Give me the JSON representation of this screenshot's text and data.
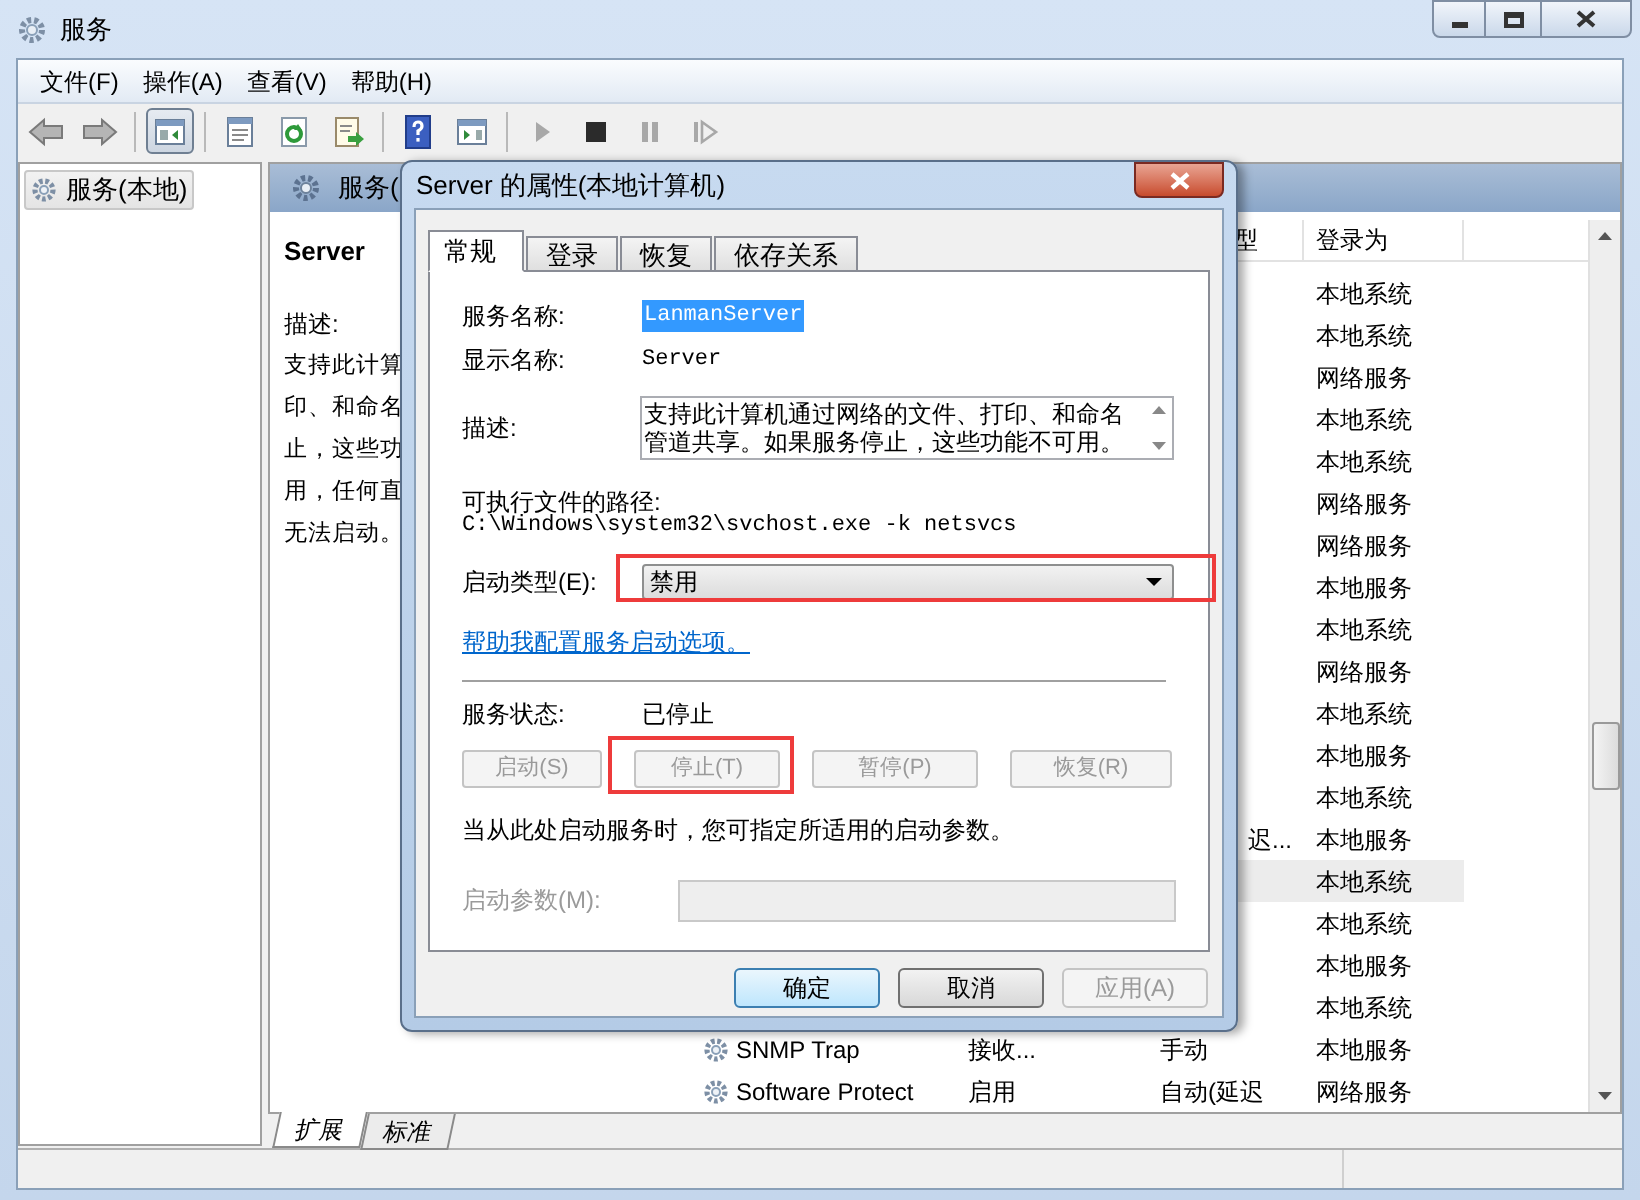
{
  "window": {
    "title": "服务"
  },
  "menu": [
    "文件(F)",
    "操作(A)",
    "查看(V)",
    "帮助(H)"
  ],
  "toolbar": [
    {
      "kind": "back"
    },
    {
      "kind": "forward"
    },
    {
      "kind": "separator"
    },
    {
      "kind": "console_tree",
      "pressed": true
    },
    {
      "kind": "separator"
    },
    {
      "kind": "properties"
    },
    {
      "kind": "refresh"
    },
    {
      "kind": "export"
    },
    {
      "kind": "separator"
    },
    {
      "kind": "help"
    },
    {
      "kind": "action_pane"
    },
    {
      "kind": "separator"
    },
    {
      "kind": "start",
      "disabled": true
    },
    {
      "kind": "stop",
      "disabled": false
    },
    {
      "kind": "pause",
      "disabled": true
    },
    {
      "kind": "restart",
      "disabled": true
    }
  ],
  "tree": [
    {
      "label": "服务(本地)",
      "selected": true
    }
  ],
  "services_panel": {
    "header": "服务(",
    "detail": {
      "title": "Server",
      "description_label": "描述:",
      "description_lines": [
        "支持此计算",
        "印、和命名",
        "止，这些功",
        "用，任何直",
        "无法启动。"
      ]
    },
    "columns": [
      "型",
      "登录为"
    ],
    "rows": [
      {
        "login_as": "本地系统",
        "selected": false
      },
      {
        "login_as": "本地系统",
        "selected": false
      },
      {
        "login_as": "网络服务",
        "selected": false
      },
      {
        "login_as": "本地系统",
        "selected": false
      },
      {
        "login_as": "本地系统",
        "selected": false
      },
      {
        "login_as": "网络服务",
        "selected": false
      },
      {
        "login_as": "网络服务",
        "selected": false
      },
      {
        "login_as": "本地服务",
        "selected": false
      },
      {
        "login_as": "本地系统",
        "selected": false
      },
      {
        "login_as": "网络服务",
        "selected": false
      },
      {
        "login_as": "本地系统",
        "selected": false
      },
      {
        "login_as": "本地服务",
        "selected": false
      },
      {
        "login_as": "本地系统",
        "selected": false
      },
      {
        "startup": "迟...",
        "login_as": "本地服务",
        "selected": false
      },
      {
        "login_as": "本地系统",
        "selected": true
      },
      {
        "login_as": "本地系统",
        "selected": false
      },
      {
        "login_as": "本地服务",
        "selected": false
      },
      {
        "login_as": "本地系统",
        "selected": false
      },
      {
        "name": "SNMP Trap",
        "description": "接收...",
        "startup": "手动",
        "login_as": "本地服务",
        "selected": false
      },
      {
        "name": "Software Protect",
        "description": "启用",
        "startup": "自动(延迟",
        "login_as": "网络服务",
        "selected": false
      }
    ]
  },
  "bottom_tabs": [
    {
      "label": "扩展",
      "selected": true
    },
    {
      "label": "标准",
      "selected": false
    }
  ],
  "dialog": {
    "title": "Server 的属性(本地计算机)",
    "tabs": [
      {
        "label": "常规",
        "selected": true
      },
      {
        "label": "登录",
        "selected": false
      },
      {
        "label": "恢复",
        "selected": false
      },
      {
        "label": "依存关系",
        "selected": false
      }
    ],
    "service_name": {
      "label": "服务名称:",
      "value": "LanmanServer",
      "selected": true
    },
    "display_name": {
      "label": "显示名称:",
      "value": "Server"
    },
    "description": {
      "label": "描述:",
      "value": "支持此计算机通过网络的文件、打印、和命名管道共享。如果服务停止，这些功能不可用。"
    },
    "path": {
      "label": "可执行文件的路径:",
      "value": "C:\\Windows\\system32\\svchost.exe -k netsvcs"
    },
    "startup_type": {
      "label": "启动类型(E):",
      "value": "禁用",
      "highlighted": true
    },
    "help_link": "帮助我配置服务启动选项。",
    "status": {
      "label": "服务状态:",
      "value": "已停止"
    },
    "service_buttons": [
      {
        "label": "启动(S)",
        "disabled": true,
        "highlighted": false
      },
      {
        "label": "停止(T)",
        "disabled": true,
        "highlighted": true
      },
      {
        "label": "暂停(P)",
        "disabled": true,
        "highlighted": false
      },
      {
        "label": "恢复(R)",
        "disabled": true,
        "highlighted": false
      }
    ],
    "start_hint": "当从此处启动服务时，您可指定所适用的启动参数。",
    "start_params": {
      "label": "启动参数(M):",
      "disabled": true
    },
    "buttons": [
      {
        "label": "确定",
        "default": true,
        "disabled": false
      },
      {
        "label": "取消",
        "default": false,
        "disabled": false
      },
      {
        "label": "应用(A)",
        "default": false,
        "disabled": true
      }
    ]
  }
}
